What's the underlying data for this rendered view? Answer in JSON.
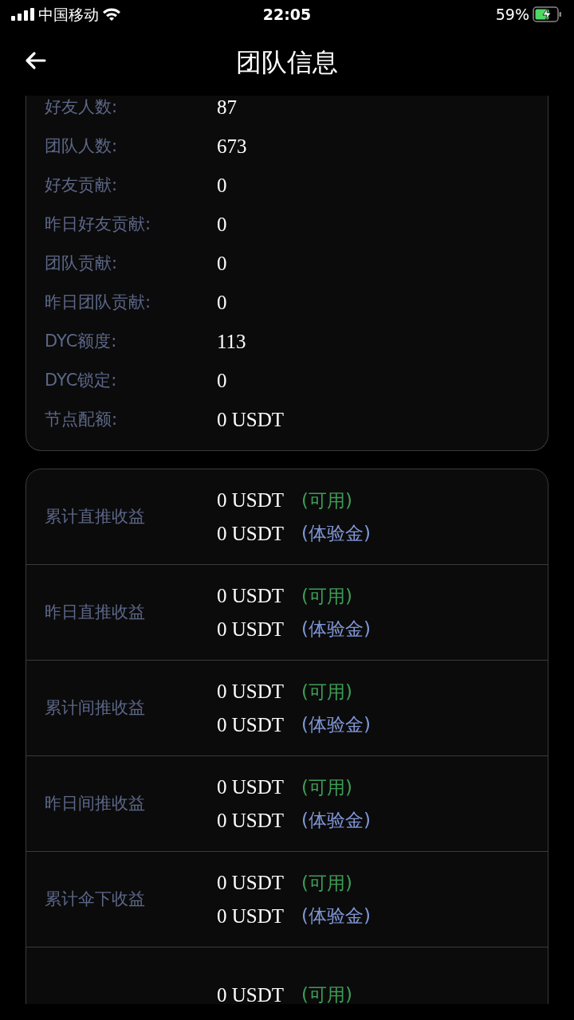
{
  "status_bar": {
    "carrier": "中国移动",
    "time": "22:05",
    "battery": "59%"
  },
  "header": {
    "title": "团队信息"
  },
  "stats": [
    {
      "label": "好友人数:",
      "value": "87"
    },
    {
      "label": "团队人数:",
      "value": "673"
    },
    {
      "label": "好友贡献:",
      "value": "0"
    },
    {
      "label": "昨日好友贡献:",
      "value": "0"
    },
    {
      "label": "团队贡献:",
      "value": "0"
    },
    {
      "label": "昨日团队贡献:",
      "value": "0"
    },
    {
      "label": "DYC额度:",
      "value": "113"
    },
    {
      "label": "DYC锁定:",
      "value": "0"
    },
    {
      "label": "节点配额:",
      "value": "0 USDT"
    }
  ],
  "incomes": [
    {
      "label": "累计直推收益",
      "amounts": [
        {
          "value": "0 USDT",
          "tag": "(可用)",
          "kind": "available"
        },
        {
          "value": "0 USDT",
          "tag": "(体验金)",
          "kind": "trial"
        }
      ]
    },
    {
      "label": "昨日直推收益",
      "amounts": [
        {
          "value": "0 USDT",
          "tag": "(可用)",
          "kind": "available"
        },
        {
          "value": "0 USDT",
          "tag": "(体验金)",
          "kind": "trial"
        }
      ]
    },
    {
      "label": "累计间推收益",
      "amounts": [
        {
          "value": "0 USDT",
          "tag": "(可用)",
          "kind": "available"
        },
        {
          "value": "0 USDT",
          "tag": "(体验金)",
          "kind": "trial"
        }
      ]
    },
    {
      "label": "昨日间推收益",
      "amounts": [
        {
          "value": "0 USDT",
          "tag": "(可用)",
          "kind": "available"
        },
        {
          "value": "0 USDT",
          "tag": "(体验金)",
          "kind": "trial"
        }
      ]
    },
    {
      "label": "累计伞下收益",
      "amounts": [
        {
          "value": "0 USDT",
          "tag": "(可用)",
          "kind": "available"
        },
        {
          "value": "0 USDT",
          "tag": "(体验金)",
          "kind": "trial"
        }
      ]
    },
    {
      "amounts": [
        {
          "value": "0 USDT",
          "tag": "(可用)",
          "kind": "available"
        }
      ]
    }
  ]
}
